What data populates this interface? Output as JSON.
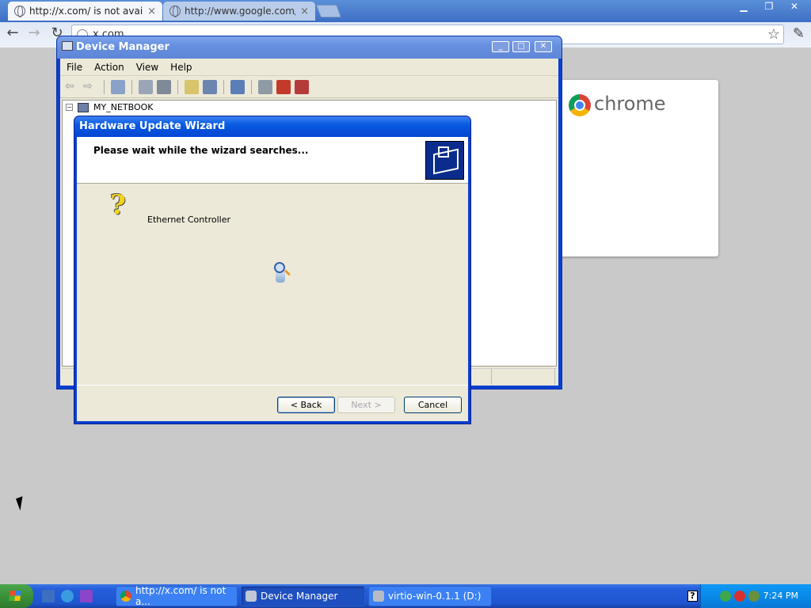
{
  "browser": {
    "tabs": [
      {
        "title": "http://x.com/ is not available",
        "active": true
      },
      {
        "title": "http://www.google.com/ is not",
        "active": false
      }
    ],
    "address": "x.com",
    "start_page_logo": "chrome"
  },
  "device_manager": {
    "title": "Device Manager",
    "menu": [
      "File",
      "Action",
      "View",
      "Help"
    ],
    "tree_root": "MY_NETBOOK"
  },
  "wizard": {
    "title": "Hardware Update Wizard",
    "heading": "Please wait while the wizard searches...",
    "device": "Ethernet Controller",
    "buttons": {
      "back": "< Back",
      "next": "Next >",
      "cancel": "Cancel"
    }
  },
  "taskbar": {
    "tasks": [
      {
        "label": "http://x.com/ is not a...",
        "icon": "chrome-icon"
      },
      {
        "label": "Device Manager",
        "icon": "device-manager-icon"
      },
      {
        "label": "virtio-win-0.1.1 (D:)",
        "icon": "drive-icon"
      }
    ],
    "clock": "7:24 PM"
  },
  "colors": {
    "xp_title_blue": "#0a5ae0",
    "window_face": "#ece9d8",
    "taskbar_blue": "#245edb",
    "start_green": "#3a913a"
  }
}
